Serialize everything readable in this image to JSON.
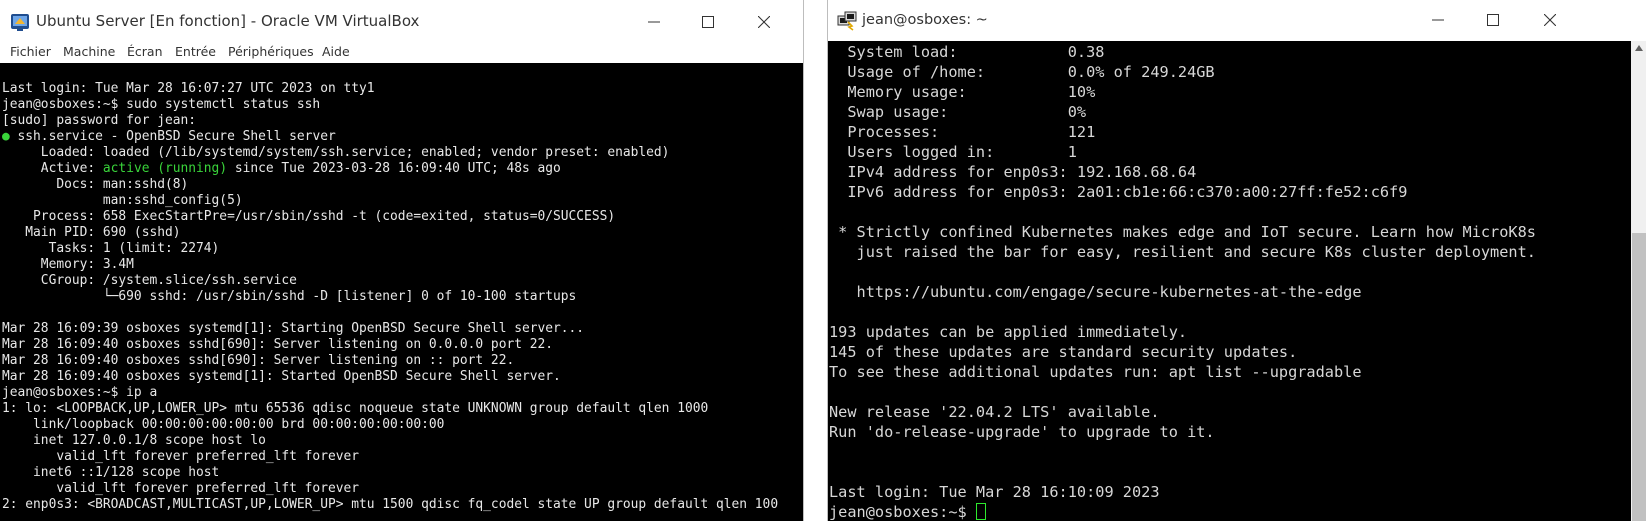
{
  "vbox": {
    "title": "Ubuntu Server [En fonction] - Oracle VM VirtualBox",
    "menu": [
      "Fichier",
      "Machine",
      "Écran",
      "Entrée",
      "Périphériques",
      "Aide"
    ],
    "console": {
      "last_login": "Last login: Tue Mar 28 16:07:27 UTC 2023 on tty1",
      "cmd1": "jean@osboxes:~$ sudo systemctl status ssh",
      "sudo_prompt": "[sudo] password for jean:",
      "service_dot": "●",
      "service_line": " ssh.service - OpenBSD Secure Shell server",
      "loaded": "     Loaded: loaded (/lib/systemd/system/ssh.service; enabled; vendor preset: enabled)",
      "active_label": "     Active: ",
      "active_state": "active (running)",
      "active_since": " since Tue 2023-03-28 16:09:40 UTC; 48s ago",
      "docs1": "       Docs: man:sshd(8)",
      "docs2": "             man:sshd_config(5)",
      "process": "    Process: 658 ExecStartPre=/usr/sbin/sshd -t (code=exited, status=0/SUCCESS)",
      "main_pid": "   Main PID: 690 (sshd)",
      "tasks": "      Tasks: 1 (limit: 2274)",
      "memory": "     Memory: 3.4M",
      "cgroup": "     CGroup: /system.slice/ssh.service",
      "cgroup_child": "             └─690 sshd: /usr/sbin/sshd -D [listener] 0 of 10-100 startups",
      "log1": "Mar 28 16:09:39 osboxes systemd[1]: Starting OpenBSD Secure Shell server...",
      "log2": "Mar 28 16:09:40 osboxes sshd[690]: Server listening on 0.0.0.0 port 22.",
      "log3": "Mar 28 16:09:40 osboxes sshd[690]: Server listening on :: port 22.",
      "log4": "Mar 28 16:09:40 osboxes systemd[1]: Started OpenBSD Secure Shell server.",
      "cmd2": "jean@osboxes:~$ ip a",
      "ip1": "1: lo: <LOOPBACK,UP,LOWER_UP> mtu 65536 qdisc noqueue state UNKNOWN group default qlen 1000",
      "ip2": "    link/loopback 00:00:00:00:00:00 brd 00:00:00:00:00:00",
      "ip3": "    inet 127.0.0.1/8 scope host lo",
      "ip4": "       valid_lft forever preferred_lft forever",
      "ip5": "    inet6 ::1/128 scope host",
      "ip6": "       valid_lft forever preferred_lft forever",
      "ip7": "2: enp0s3: <BROADCAST,MULTICAST,UP,LOWER_UP> mtu 1500 qdisc fq_codel state UP group default qlen 100"
    }
  },
  "putty": {
    "title": "jean@osboxes: ~",
    "console": {
      "l1": "  System load:            0.38",
      "l2": "  Usage of /home:         0.0% of 249.24GB",
      "l3": "  Memory usage:           10%",
      "l4": "  Swap usage:             0%",
      "l5": "  Processes:              121",
      "l6": "  Users logged in:        1",
      "l7": "  IPv4 address for enp0s3: 192.168.68.64",
      "l8": "  IPv6 address for enp0s3: 2a01:cb1e:66:c370:a00:27ff:fe52:c6f9",
      "l9": "",
      "l10": " * Strictly confined Kubernetes makes edge and IoT secure. Learn how MicroK8s",
      "l11": "   just raised the bar for easy, resilient and secure K8s cluster deployment.",
      "l12": "",
      "l13": "   https://ubuntu.com/engage/secure-kubernetes-at-the-edge",
      "l14": "",
      "l15": "193 updates can be applied immediately.",
      "l16": "145 of these updates are standard security updates.",
      "l17": "To see these additional updates run: apt list --upgradable",
      "l18": "",
      "l19": "New release '22.04.2 LTS' available.",
      "l20": "Run 'do-release-upgrade' to upgrade to it.",
      "l21": "",
      "l22": "",
      "l23": "Last login: Tue Mar 28 16:10:09 2023",
      "prompt": "jean@osboxes:~$ "
    }
  },
  "colors": {
    "terminal_bg": "#000000",
    "console_text": "#e8e8e8",
    "active_green": "#39d43a",
    "cursor_green": "#2ee82e"
  }
}
